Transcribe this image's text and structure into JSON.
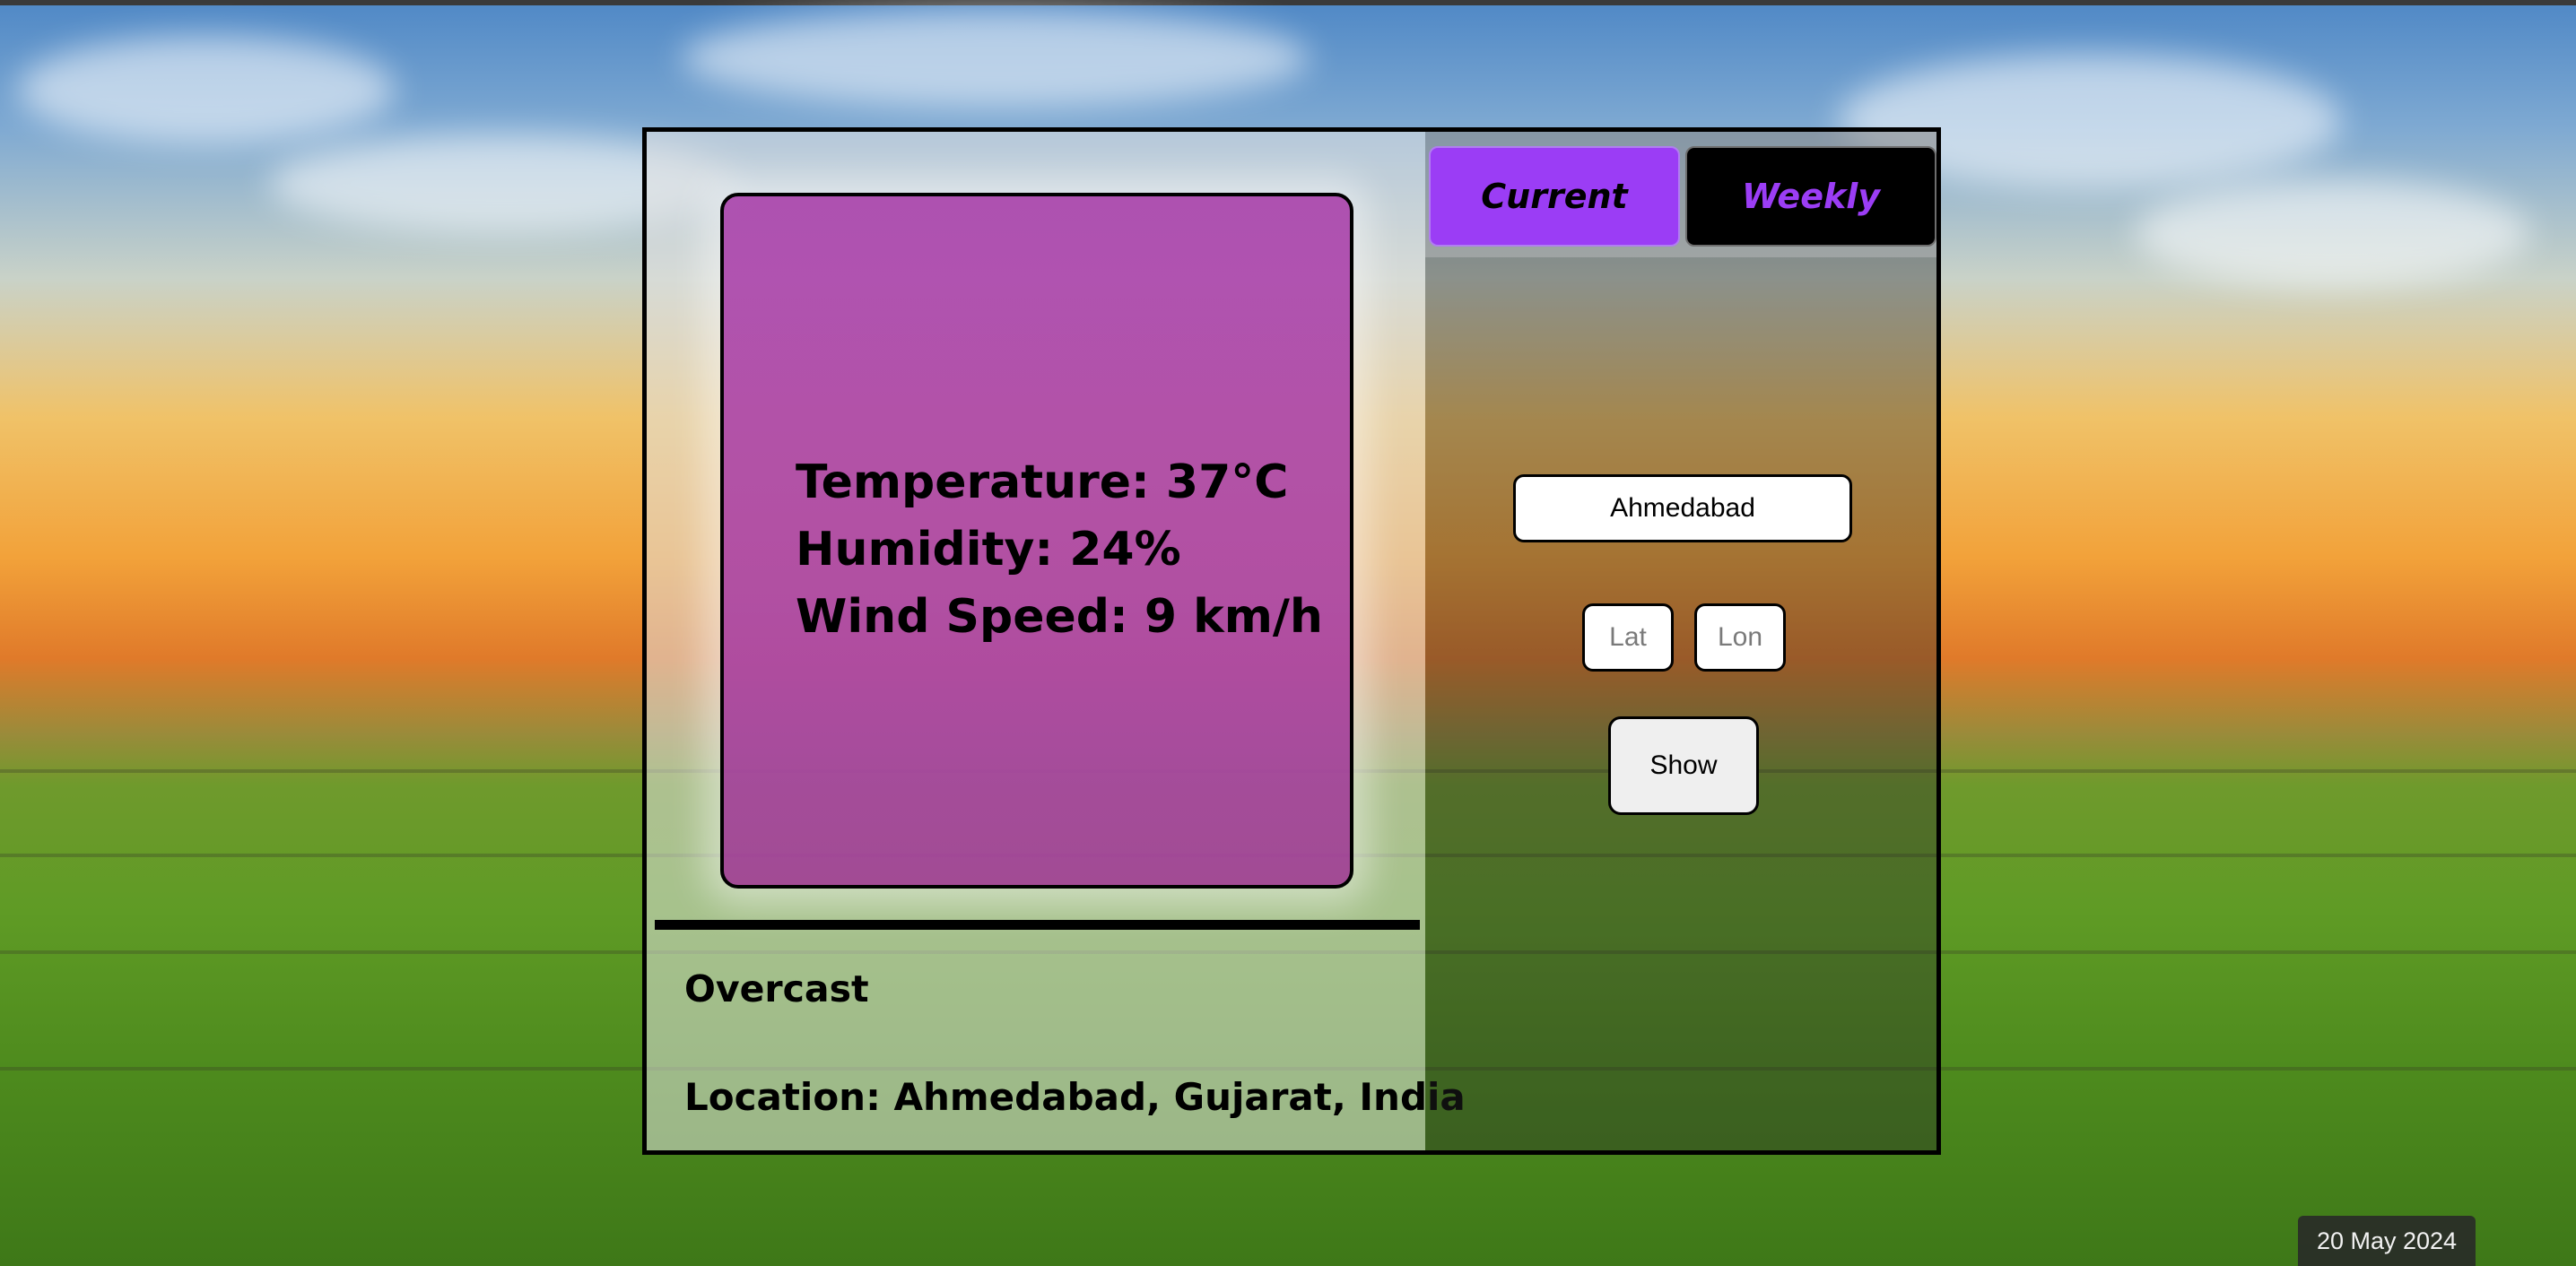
{
  "weather": {
    "temperature": "Temperature: 37°C",
    "humidity": "Humidity: 24%",
    "wind_speed": "Wind Speed: 9 km/h",
    "condition": "Overcast",
    "location": "Location: Ahmedabad, Gujarat, India"
  },
  "tabs": {
    "current_label": "Current",
    "weekly_label": "Weekly",
    "active": "Current"
  },
  "form": {
    "city_value": "Ahmedabad",
    "lat_placeholder": "Lat",
    "lon_placeholder": "Lon",
    "show_label": "Show"
  },
  "taskbar": {
    "date": "20 May 2024"
  },
  "colors": {
    "accent": "#9b3df5",
    "card": "#a83ca8",
    "weekly_tab_bg": "#000000"
  }
}
